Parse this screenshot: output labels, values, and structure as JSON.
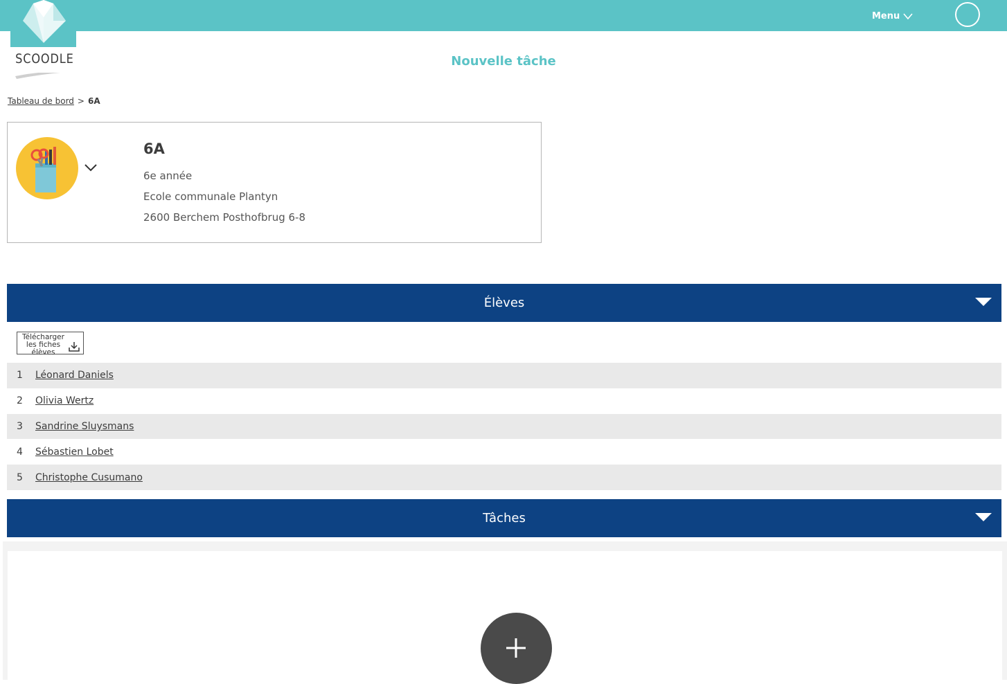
{
  "header": {
    "logo_text": "SCOODLE",
    "menu_label": "Menu",
    "page_title": "Nouvelle tâche"
  },
  "breadcrumb": {
    "root": "Tableau de bord",
    "separator": ">",
    "current": "6A"
  },
  "class_card": {
    "name": "6A",
    "grade": "6e année",
    "school": "Ecole communale Plantyn",
    "address": "2600 Berchem Posthofbrug 6-8"
  },
  "students_section": {
    "title": "Élèves",
    "download_label_1": "Télécharger",
    "download_label_2": "les fiches",
    "download_label_3": "élèves",
    "students": [
      {
        "num": "1",
        "name": "Léonard Daniels"
      },
      {
        "num": "2",
        "name": "Olivia Wertz"
      },
      {
        "num": "3",
        "name": "Sandrine Sluysmans"
      },
      {
        "num": "4",
        "name": "Sébastien Lobet"
      },
      {
        "num": "5",
        "name": "Christophe Cusumano"
      }
    ]
  },
  "tasks_section": {
    "title": "Tâches"
  },
  "colors": {
    "teal": "#5bc3c6",
    "navy": "#0d4283",
    "row_gray": "#e9e9e9",
    "add_button": "#4a4a4a"
  },
  "icons": {
    "menu": "chevron-down-icon",
    "class": "pencil-cup-icon",
    "section": "triangle-down-icon",
    "download": "download-icon",
    "add": "plus-icon"
  }
}
